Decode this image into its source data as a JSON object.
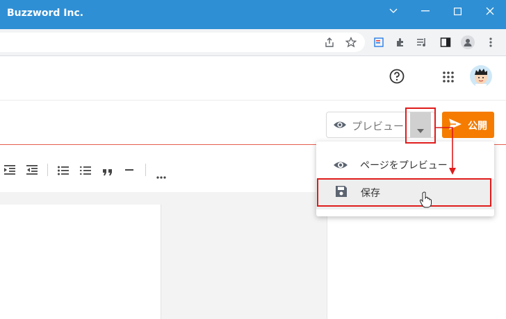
{
  "window": {
    "title": "Buzzword Inc.",
    "controls": [
      "chevron-down",
      "minimize",
      "maximize",
      "close"
    ]
  },
  "browser_toolbar": {
    "icons": [
      "share-icon",
      "star-icon",
      "page-icon",
      "extensions-icon",
      "media-icon",
      "sidepanel-icon",
      "profile-icon",
      "more-icon"
    ]
  },
  "app_header": {
    "icons": [
      "help-icon",
      "apps-grid-icon",
      "avatar"
    ]
  },
  "editor_header": {
    "preview_label": "プレビュー",
    "publish_label": "公開"
  },
  "format_toolbar": {
    "icons": [
      "indent-icon",
      "outdent-icon",
      "bullet-list-icon",
      "numbered-list-icon",
      "quote-icon",
      "horizontal-rule-icon",
      "more-icon"
    ]
  },
  "dropdown_menu": {
    "items": [
      {
        "label": "ページをプレビュー",
        "icon": "eye-icon"
      },
      {
        "label": "保存",
        "icon": "save-icon"
      }
    ]
  },
  "colors": {
    "titlebar": "#2f8fd4",
    "publish": "#f57c00",
    "annotation": "#e01b1b"
  }
}
